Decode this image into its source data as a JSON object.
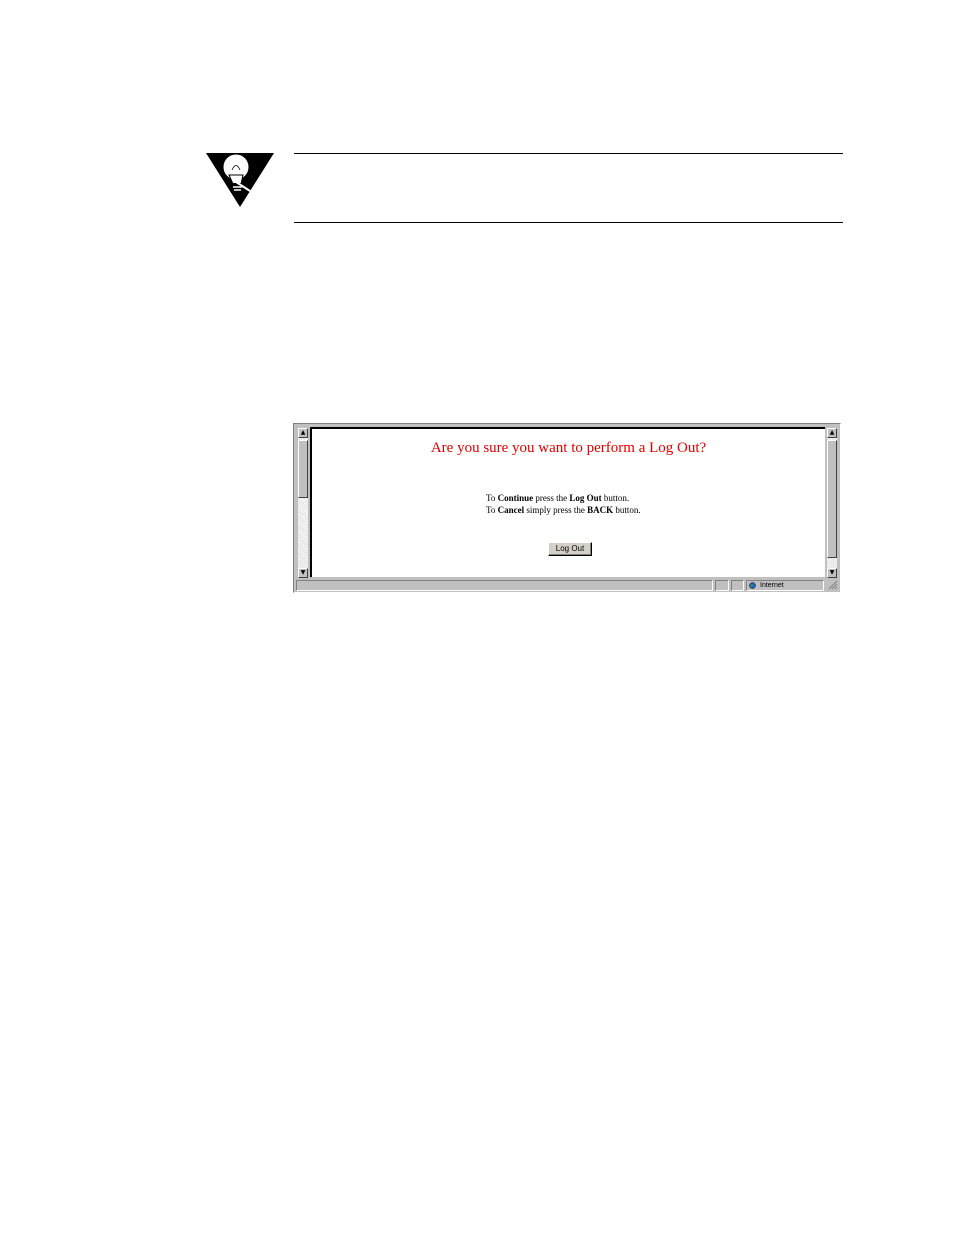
{
  "browser": {
    "page_title": "Are you sure you want to perform a Log Out?",
    "instructions": {
      "line1": {
        "pre": "To ",
        "bold1": "Continue",
        "mid": " press the ",
        "bold2": "Log Out",
        "post": " button."
      },
      "line2": {
        "pre": "To ",
        "bold1": "Cancel",
        "mid": " simply press the ",
        "bold2": "BACK",
        "post": " button."
      }
    },
    "logout_button_label": "Log Out",
    "status_zone": "Internet"
  },
  "colors": {
    "title": "#e00000",
    "chrome": "#c0c0c0"
  },
  "icons": {
    "note": "lightbulb-note-icon",
    "zone": "globe-icon"
  }
}
